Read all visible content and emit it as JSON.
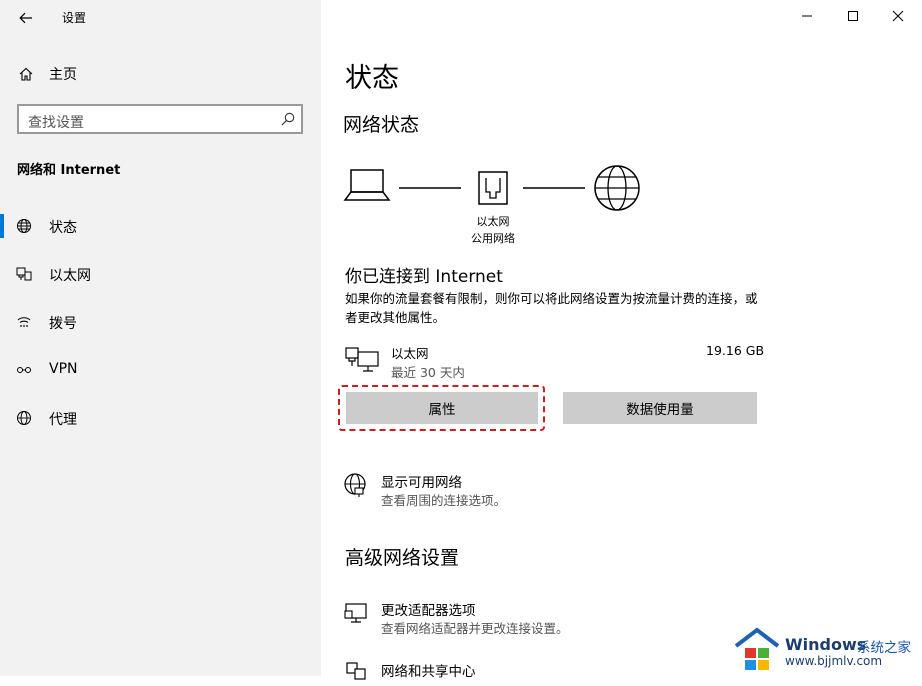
{
  "window": {
    "title": "设置"
  },
  "sidebar": {
    "home_label": "主页",
    "search_placeholder": "查找设置",
    "section_title": "网络和 Internet",
    "items": [
      {
        "label": "状态",
        "icon": "globe-status-icon",
        "active": true
      },
      {
        "label": "以太网",
        "icon": "ethernet-icon",
        "active": false
      },
      {
        "label": "拨号",
        "icon": "dialup-icon",
        "active": false
      },
      {
        "label": "VPN",
        "icon": "vpn-icon",
        "active": false
      },
      {
        "label": "代理",
        "icon": "globe-icon",
        "active": false
      }
    ]
  },
  "main": {
    "title": "状态",
    "network_status_heading": "网络状态",
    "diagram": {
      "node_label_line1": "以太网",
      "node_label_line2": "公用网络"
    },
    "connected_title": "你已连接到 Internet",
    "description": "如果你的流量套餐有限制，则你可以将此网络设置为按流量计费的连接，或者更改其他属性。",
    "connection": {
      "name": "以太网",
      "period": "最近 30 天内",
      "usage": "19.16 GB"
    },
    "buttons": {
      "properties": "属性",
      "data_usage": "数据使用量"
    },
    "show_networks": {
      "title": "显示可用网络",
      "subtitle": "查看周围的连接选项。"
    },
    "advanced_heading": "高级网络设置",
    "adapter_options": {
      "title": "更改适配器选项",
      "subtitle": "查看网络适配器并更改连接设置。"
    },
    "sharing_center": {
      "title": "网络和共享中心"
    }
  },
  "watermark": {
    "brand": "Windows",
    "cn": "系统之家",
    "url": "www.bjjmlv.com"
  },
  "colors": {
    "accent": "#0078d7",
    "highlight": "#cc1e1e",
    "sidebar_bg": "#f2f2f2",
    "button_bg": "#cccccc"
  }
}
